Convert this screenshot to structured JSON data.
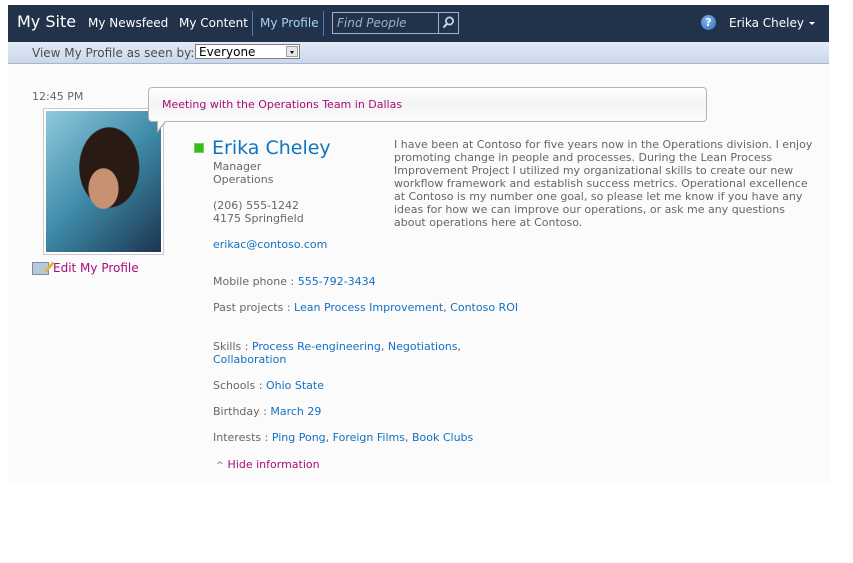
{
  "header": {
    "site_title": "My Site",
    "nav": [
      "My Newsfeed",
      "My Content",
      "My Profile"
    ],
    "active_nav": "My Profile",
    "search_placeholder": "Find People",
    "user_name": "Erika Cheley",
    "help_glyph": "?"
  },
  "subbar": {
    "label": "View My Profile as seen by:",
    "selected": "Everyone"
  },
  "status": {
    "time": "12:45 PM",
    "message": "Meeting with the Operations Team in Dallas"
  },
  "profile": {
    "name": "Erika Cheley",
    "title": "Manager",
    "department": "Operations",
    "phone": "(206) 555-1242",
    "office": "4175 Springfield",
    "email": "erikac@contoso.com",
    "presence_color": "#3bbb1b",
    "edit_label": "Edit My Profile",
    "about": "I have been at Contoso for five years now in the Operations division.  I enjoy promoting change in people and processes. During the Lean Process Improvement Project I utilized my organizational skills to create our new workflow framework and establish success metrics. Operational excellence at Contoso is my number one goal, so please let me know if you have any ideas for how we can improve our operations, or ask me any questions about operations here at Contoso."
  },
  "fields": [
    {
      "label": "Mobile phone : ",
      "values": [
        "555-792-3434"
      ]
    },
    {
      "label": "Past projects : ",
      "values": [
        "Lean Process Improvement",
        "Contoso ROI"
      ]
    },
    {
      "label": "Skills : ",
      "values": [
        "Process Re-engineering",
        "Negotiations",
        "Collaboration"
      ]
    },
    {
      "label": "Schools : ",
      "values": [
        "Ohio State"
      ]
    },
    {
      "label": "Birthday : ",
      "values": [
        "March 29"
      ]
    },
    {
      "label": "Interests : ",
      "values": [
        "Ping Pong",
        "Foreign Films",
        "Book Clubs"
      ]
    }
  ],
  "hide_label": "Hide information",
  "colors": {
    "topbar": "#21324a",
    "link": "#1470c3",
    "accent_magenta": "#a50e7b",
    "name_blue": "#0f75bd"
  }
}
